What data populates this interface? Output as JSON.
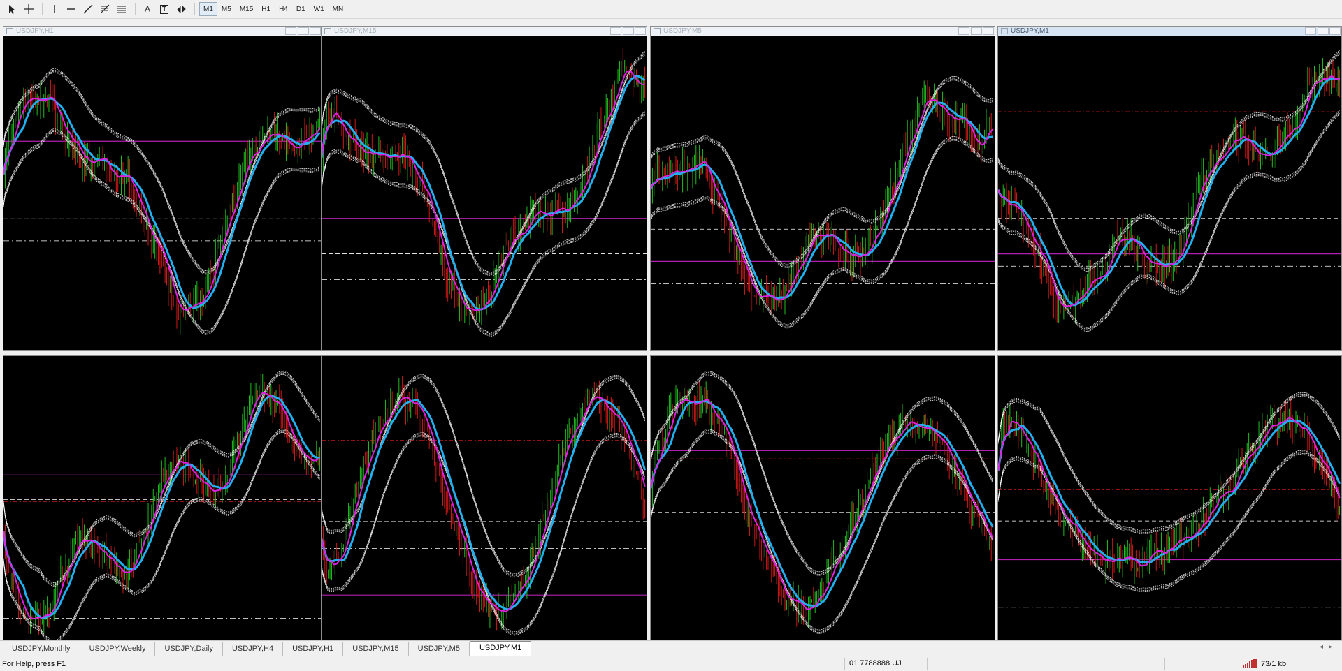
{
  "toolbar": {
    "tools": [
      {
        "name": "cursor-icon"
      },
      {
        "name": "crosshair-icon"
      },
      {
        "name": "vertical-line-icon"
      },
      {
        "name": "horizontal-line-icon"
      },
      {
        "name": "trendline-icon"
      },
      {
        "name": "fibonacci-icon"
      },
      {
        "name": "channel-icon"
      },
      {
        "name": "text-tool-icon",
        "label": "A"
      },
      {
        "name": "text-label-icon",
        "label": "T"
      },
      {
        "name": "arrows-icon"
      }
    ],
    "timeframes": [
      "M1",
      "M5",
      "M15",
      "H1",
      "H4",
      "D1",
      "W1",
      "MN"
    ],
    "active_timeframe": "M1"
  },
  "charts": [
    {
      "title": "USDJPY,H1",
      "active": false
    },
    {
      "title": "USDJPY,M15",
      "active": false
    },
    {
      "title": "USDJPY,M5",
      "active": false
    },
    {
      "title": "USDJPY,M1",
      "active": true
    },
    {
      "title": "",
      "active": false
    },
    {
      "title": "",
      "active": false
    },
    {
      "title": "",
      "active": false
    },
    {
      "title": "",
      "active": false
    }
  ],
  "colors": {
    "background": "#000000",
    "bull_candle": "#1fbf1f",
    "bear_candle": "#d01818",
    "ma_fast": "#e020e0",
    "ma_slow": "#20b0f0",
    "band": "#ffffff",
    "level_magenta": "#b020b0",
    "level_red": "#c81818"
  },
  "tabs": {
    "items": [
      "USDJPY,Monthly",
      "USDJPY,Weekly",
      "USDJPY,Daily",
      "USDJPY,H4",
      "USDJPY,H1",
      "USDJPY,M15",
      "USDJPY,M5",
      "USDJPY,M1"
    ],
    "active": "USDJPY,M1",
    "scroll_left": "◂",
    "scroll_right": "▸"
  },
  "status": {
    "help": "For Help, press F1",
    "profile": "01 7788888 UJ",
    "traffic": "73/1 kb"
  }
}
